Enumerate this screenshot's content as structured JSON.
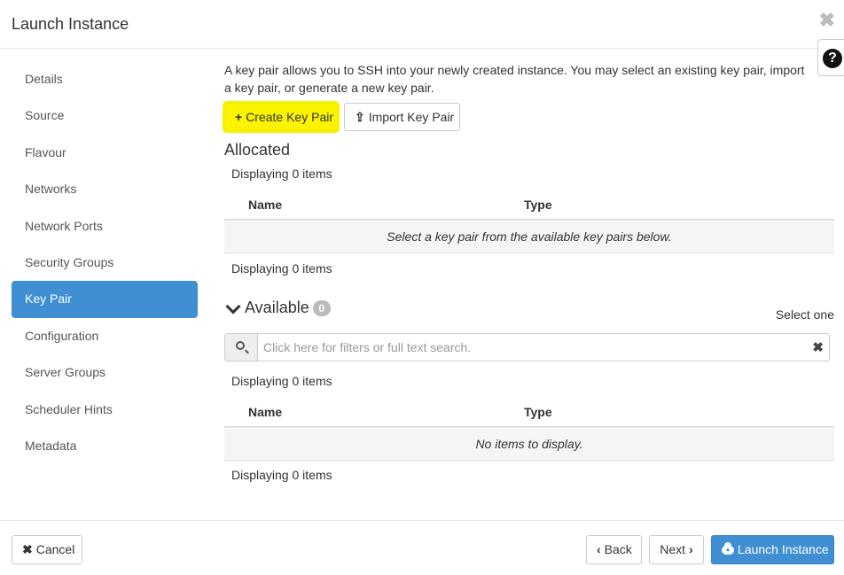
{
  "dialog": {
    "title": "Launch Instance",
    "close_icon": "close-icon",
    "help_icon": "question-circle-icon"
  },
  "sidebar": {
    "items": [
      {
        "label": "Details",
        "active": false
      },
      {
        "label": "Source",
        "active": false
      },
      {
        "label": "Flavour",
        "active": false
      },
      {
        "label": "Networks",
        "active": false
      },
      {
        "label": "Network Ports",
        "active": false
      },
      {
        "label": "Security Groups",
        "active": false
      },
      {
        "label": "Key Pair",
        "active": true
      },
      {
        "label": "Configuration",
        "active": false
      },
      {
        "label": "Server Groups",
        "active": false
      },
      {
        "label": "Scheduler Hints",
        "active": false
      },
      {
        "label": "Metadata",
        "active": false
      }
    ]
  },
  "main": {
    "intro": "A key pair allows you to SSH into your newly created instance. You may select an existing key pair, import a key pair, or generate a new key pair.",
    "create_button": "Create Key Pair",
    "import_button": "Import Key Pair",
    "allocated": {
      "title": "Allocated",
      "displaying_top": "Displaying 0 items",
      "columns": [
        "Name",
        "Type"
      ],
      "empty_message": "Select a key pair from the available key pairs below.",
      "displaying_bottom": "Displaying 0 items"
    },
    "available": {
      "title": "Available",
      "count": "0",
      "select_hint": "Select one",
      "search_placeholder": "Click here for filters or full text search.",
      "displaying_top": "Displaying 0 items",
      "columns": [
        "Name",
        "Type"
      ],
      "empty_message": "No items to display.",
      "displaying_bottom": "Displaying 0 items"
    }
  },
  "footer": {
    "cancel": "Cancel",
    "back": "Back",
    "next": "Next",
    "launch": "Launch Instance"
  },
  "colors": {
    "accent": "#3f8fd2",
    "highlight": "#fbf300"
  }
}
